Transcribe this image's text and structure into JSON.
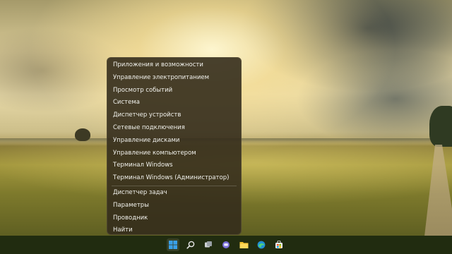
{
  "context_menu": {
    "group1": [
      "Приложения и возможности",
      "Управление электропитанием",
      "Просмотр событий",
      "Система",
      "Диспетчер устройств",
      "Сетевые подключения",
      "Управление дисками",
      "Управление компьютером",
      "Терминал Windows",
      "Терминал Windows (Администратор)"
    ],
    "group2": [
      "Диспетчер задач",
      "Параметры",
      "Проводник",
      "Найти"
    ]
  },
  "taskbar": {
    "icons": [
      "windows-start-icon",
      "search-icon",
      "task-view-icon",
      "chat-icon",
      "file-explorer-icon",
      "edge-browser-icon",
      "store-icon"
    ],
    "accent": "#3aa0e8"
  }
}
